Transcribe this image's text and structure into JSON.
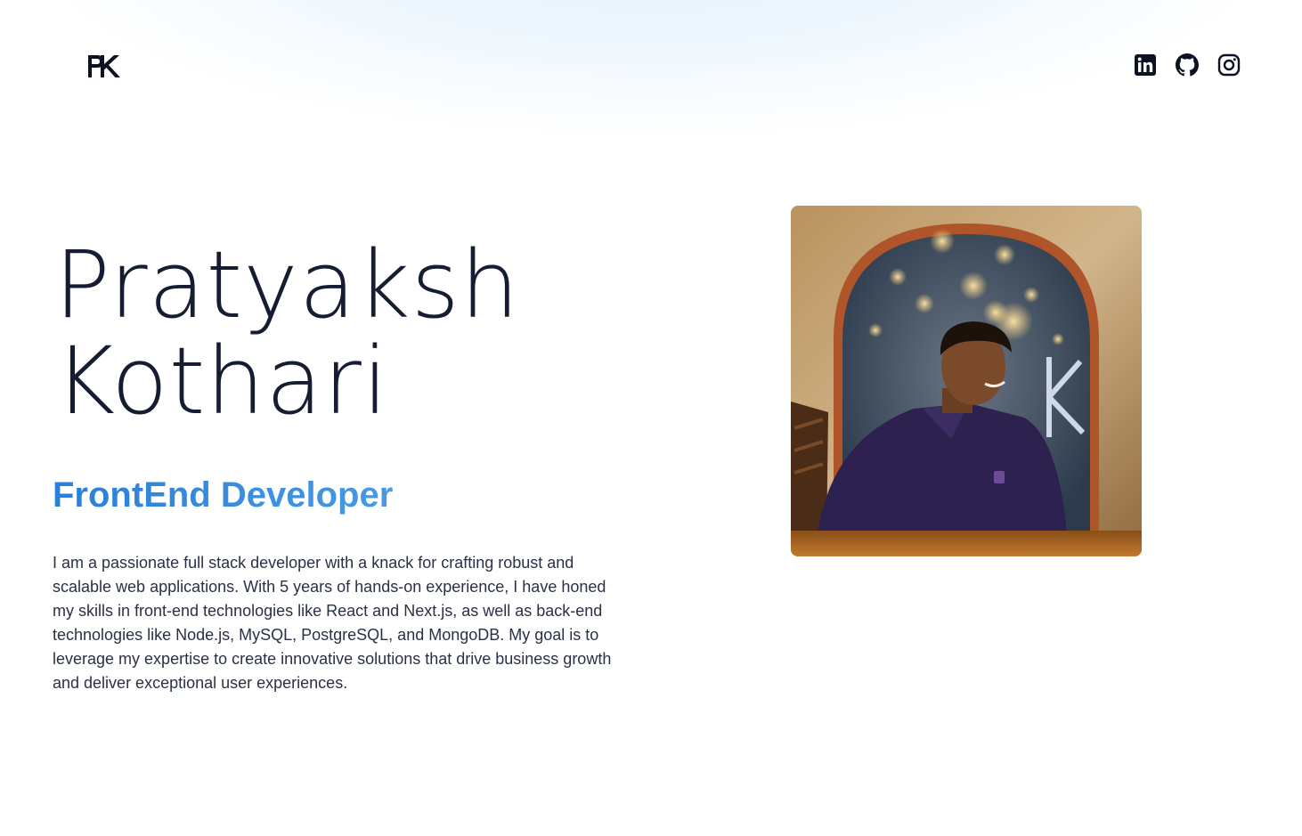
{
  "header": {
    "logo_text": "PK",
    "socials": [
      {
        "name": "linkedin-icon"
      },
      {
        "name": "github-icon"
      },
      {
        "name": "instagram-icon"
      }
    ]
  },
  "hero": {
    "first_name": "Pratyaksh",
    "last_name": "Kothari",
    "role": "FrontEnd Developer",
    "bio": "I am a passionate full stack developer with a knack for crafting robust and scalable web applications. With 5 years of hands-on experience, I have honed my skills in front-end technologies like React and Next.js, as well as back-end technologies like Node.js, MySQL, PostgreSQL, and MongoDB. My goal is to leverage my expertise to create innovative solutions that drive business growth and deliver exceptional user experiences."
  },
  "colors": {
    "accent": "#2f86d9",
    "text": "#161d33",
    "glow": "#e3f1fd"
  }
}
